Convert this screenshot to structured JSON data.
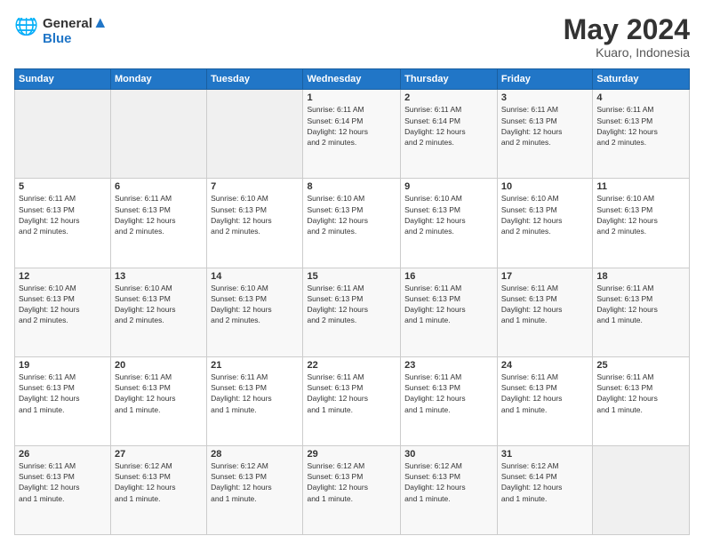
{
  "logo": {
    "line1": "General",
    "line2": "Blue"
  },
  "title": "May 2024",
  "subtitle": "Kuaro, Indonesia",
  "header_days": [
    "Sunday",
    "Monday",
    "Tuesday",
    "Wednesday",
    "Thursday",
    "Friday",
    "Saturday"
  ],
  "weeks": [
    [
      {
        "day": "",
        "info": ""
      },
      {
        "day": "",
        "info": ""
      },
      {
        "day": "",
        "info": ""
      },
      {
        "day": "1",
        "info": "Sunrise: 6:11 AM\nSunset: 6:14 PM\nDaylight: 12 hours\nand 2 minutes."
      },
      {
        "day": "2",
        "info": "Sunrise: 6:11 AM\nSunset: 6:14 PM\nDaylight: 12 hours\nand 2 minutes."
      },
      {
        "day": "3",
        "info": "Sunrise: 6:11 AM\nSunset: 6:13 PM\nDaylight: 12 hours\nand 2 minutes."
      },
      {
        "day": "4",
        "info": "Sunrise: 6:11 AM\nSunset: 6:13 PM\nDaylight: 12 hours\nand 2 minutes."
      }
    ],
    [
      {
        "day": "5",
        "info": "Sunrise: 6:11 AM\nSunset: 6:13 PM\nDaylight: 12 hours\nand 2 minutes."
      },
      {
        "day": "6",
        "info": "Sunrise: 6:11 AM\nSunset: 6:13 PM\nDaylight: 12 hours\nand 2 minutes."
      },
      {
        "day": "7",
        "info": "Sunrise: 6:10 AM\nSunset: 6:13 PM\nDaylight: 12 hours\nand 2 minutes."
      },
      {
        "day": "8",
        "info": "Sunrise: 6:10 AM\nSunset: 6:13 PM\nDaylight: 12 hours\nand 2 minutes."
      },
      {
        "day": "9",
        "info": "Sunrise: 6:10 AM\nSunset: 6:13 PM\nDaylight: 12 hours\nand 2 minutes."
      },
      {
        "day": "10",
        "info": "Sunrise: 6:10 AM\nSunset: 6:13 PM\nDaylight: 12 hours\nand 2 minutes."
      },
      {
        "day": "11",
        "info": "Sunrise: 6:10 AM\nSunset: 6:13 PM\nDaylight: 12 hours\nand 2 minutes."
      }
    ],
    [
      {
        "day": "12",
        "info": "Sunrise: 6:10 AM\nSunset: 6:13 PM\nDaylight: 12 hours\nand 2 minutes."
      },
      {
        "day": "13",
        "info": "Sunrise: 6:10 AM\nSunset: 6:13 PM\nDaylight: 12 hours\nand 2 minutes."
      },
      {
        "day": "14",
        "info": "Sunrise: 6:10 AM\nSunset: 6:13 PM\nDaylight: 12 hours\nand 2 minutes."
      },
      {
        "day": "15",
        "info": "Sunrise: 6:11 AM\nSunset: 6:13 PM\nDaylight: 12 hours\nand 2 minutes."
      },
      {
        "day": "16",
        "info": "Sunrise: 6:11 AM\nSunset: 6:13 PM\nDaylight: 12 hours\nand 1 minute."
      },
      {
        "day": "17",
        "info": "Sunrise: 6:11 AM\nSunset: 6:13 PM\nDaylight: 12 hours\nand 1 minute."
      },
      {
        "day": "18",
        "info": "Sunrise: 6:11 AM\nSunset: 6:13 PM\nDaylight: 12 hours\nand 1 minute."
      }
    ],
    [
      {
        "day": "19",
        "info": "Sunrise: 6:11 AM\nSunset: 6:13 PM\nDaylight: 12 hours\nand 1 minute."
      },
      {
        "day": "20",
        "info": "Sunrise: 6:11 AM\nSunset: 6:13 PM\nDaylight: 12 hours\nand 1 minute."
      },
      {
        "day": "21",
        "info": "Sunrise: 6:11 AM\nSunset: 6:13 PM\nDaylight: 12 hours\nand 1 minute."
      },
      {
        "day": "22",
        "info": "Sunrise: 6:11 AM\nSunset: 6:13 PM\nDaylight: 12 hours\nand 1 minute."
      },
      {
        "day": "23",
        "info": "Sunrise: 6:11 AM\nSunset: 6:13 PM\nDaylight: 12 hours\nand 1 minute."
      },
      {
        "day": "24",
        "info": "Sunrise: 6:11 AM\nSunset: 6:13 PM\nDaylight: 12 hours\nand 1 minute."
      },
      {
        "day": "25",
        "info": "Sunrise: 6:11 AM\nSunset: 6:13 PM\nDaylight: 12 hours\nand 1 minute."
      }
    ],
    [
      {
        "day": "26",
        "info": "Sunrise: 6:11 AM\nSunset: 6:13 PM\nDaylight: 12 hours\nand 1 minute."
      },
      {
        "day": "27",
        "info": "Sunrise: 6:12 AM\nSunset: 6:13 PM\nDaylight: 12 hours\nand 1 minute."
      },
      {
        "day": "28",
        "info": "Sunrise: 6:12 AM\nSunset: 6:13 PM\nDaylight: 12 hours\nand 1 minute."
      },
      {
        "day": "29",
        "info": "Sunrise: 6:12 AM\nSunset: 6:13 PM\nDaylight: 12 hours\nand 1 minute."
      },
      {
        "day": "30",
        "info": "Sunrise: 6:12 AM\nSunset: 6:13 PM\nDaylight: 12 hours\nand 1 minute."
      },
      {
        "day": "31",
        "info": "Sunrise: 6:12 AM\nSunset: 6:14 PM\nDaylight: 12 hours\nand 1 minute."
      },
      {
        "day": "",
        "info": ""
      }
    ]
  ]
}
